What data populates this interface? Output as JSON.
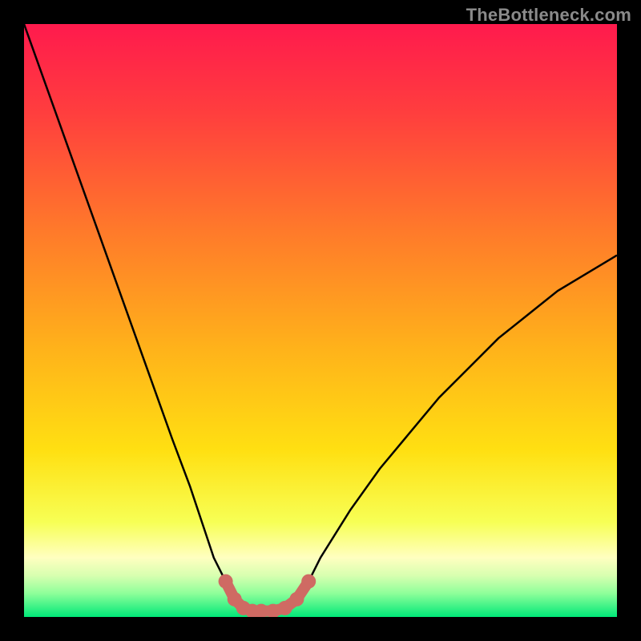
{
  "watermark": "TheBottleneck.com",
  "chart_data": {
    "type": "line",
    "title": "",
    "xlabel": "",
    "ylabel": "",
    "xlim": [
      0,
      100
    ],
    "ylim": [
      0,
      100
    ],
    "series": [
      {
        "name": "bottleneck-curve",
        "x": [
          0,
          5,
          10,
          15,
          20,
          25,
          28,
          30,
          32,
          34,
          35.5,
          37,
          38.5,
          40,
          42,
          44,
          46,
          48,
          50,
          55,
          60,
          65,
          70,
          75,
          80,
          85,
          90,
          95,
          100
        ],
        "y": [
          100,
          86,
          72,
          58,
          44,
          30,
          22,
          16,
          10,
          6,
          3,
          1.5,
          1,
          1,
          1,
          1.5,
          3,
          6,
          10,
          18,
          25,
          31,
          37,
          42,
          47,
          51,
          55,
          58,
          61
        ]
      }
    ],
    "markers": {
      "name": "highlight-region",
      "color": "#cf6a63",
      "points": [
        {
          "x": 34,
          "y": 6
        },
        {
          "x": 35.5,
          "y": 3
        },
        {
          "x": 37,
          "y": 1.5
        },
        {
          "x": 38.5,
          "y": 1
        },
        {
          "x": 40,
          "y": 1
        },
        {
          "x": 42,
          "y": 1
        },
        {
          "x": 44,
          "y": 1.5
        },
        {
          "x": 46,
          "y": 3
        },
        {
          "x": 48,
          "y": 6
        }
      ]
    },
    "gradient_stops": [
      {
        "pct": 0,
        "color": "#ff1a4d"
      },
      {
        "pct": 15,
        "color": "#ff3e3e"
      },
      {
        "pct": 35,
        "color": "#ff7a2a"
      },
      {
        "pct": 55,
        "color": "#ffb31a"
      },
      {
        "pct": 72,
        "color": "#ffe012"
      },
      {
        "pct": 84,
        "color": "#f7ff55"
      },
      {
        "pct": 90,
        "color": "#ffffc0"
      },
      {
        "pct": 93,
        "color": "#d8ffb0"
      },
      {
        "pct": 96,
        "color": "#8fff9a"
      },
      {
        "pct": 100,
        "color": "#00e878"
      }
    ]
  }
}
